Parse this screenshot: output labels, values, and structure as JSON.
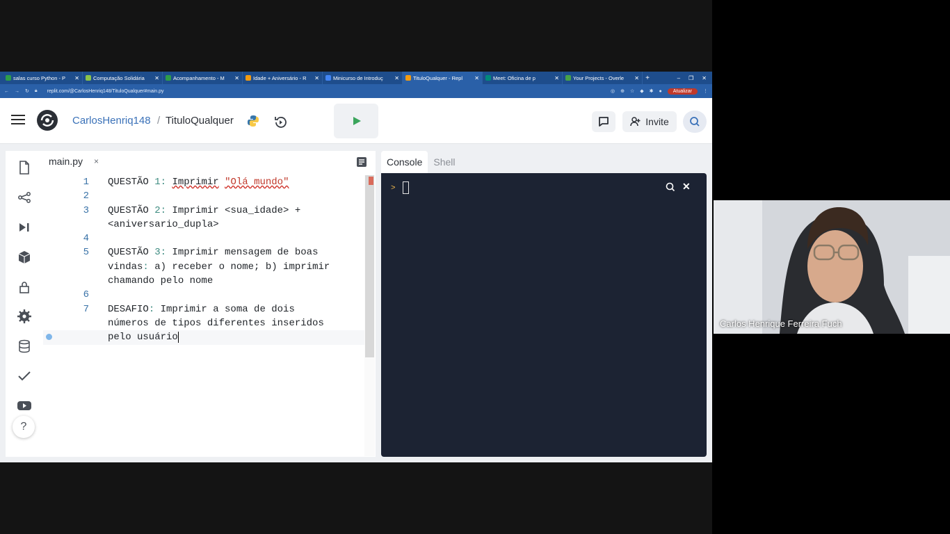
{
  "browser": {
    "tabs": [
      {
        "title": "salas curso Python - P",
        "color": "#2e9d49"
      },
      {
        "title": "Computação Solidária",
        "color": "#8bc34a"
      },
      {
        "title": "Acompanhamento - M",
        "color": "#2e9d49"
      },
      {
        "title": "Idade + Aniversário - R",
        "color": "#f29b11"
      },
      {
        "title": "Minicurso de Introduç",
        "color": "#4285f4"
      },
      {
        "title": "TituloQualquer - Repl",
        "color": "#f29b11"
      },
      {
        "title": "Meet: Oficina de p",
        "color": "#00897b"
      },
      {
        "title": "Your Projects - Overle",
        "color": "#47a248"
      }
    ],
    "active_tab": 5,
    "url": "replit.com/@CarlosHenriq148/TituloQualquer#main.py",
    "update_label": "Atualizar"
  },
  "header": {
    "username": "CarlosHenriq148",
    "separator": "/",
    "repl_name": "TituloQualquer",
    "invite_label": "Invite"
  },
  "editor": {
    "file_tab": "main.py",
    "close_symbol": "×"
  },
  "console": {
    "tabs": [
      "Console",
      "Shell"
    ],
    "prompt": ">",
    "close_symbol": "✕"
  },
  "help_label": "?",
  "participant": {
    "name": "Carlos Henrique Ferreira Fuch"
  },
  "colors": {
    "accent": "#3a71b8",
    "run_green": "#3ba55c",
    "terminal_bg": "#1c2333",
    "comment": "#3d8b80",
    "string": "#c0392b"
  }
}
